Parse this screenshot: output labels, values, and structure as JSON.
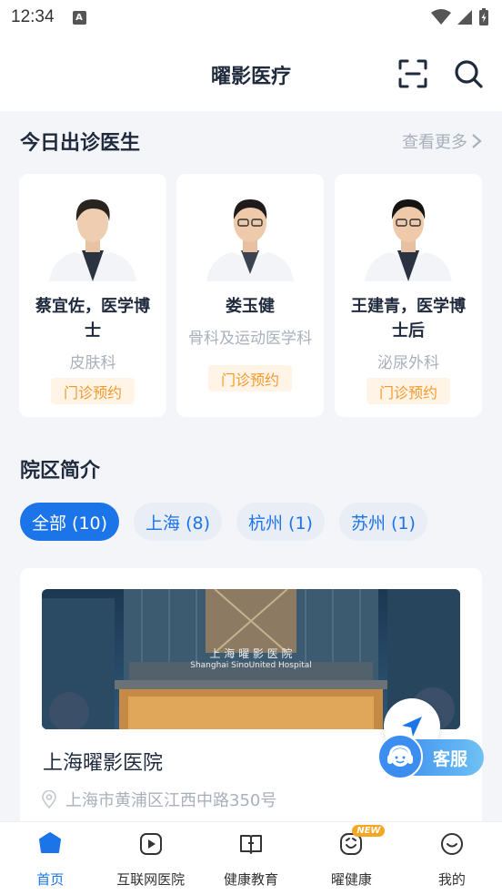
{
  "status_bar": {
    "time": "12:34",
    "notif_letter": "A"
  },
  "header": {
    "title": "曜影医疗",
    "scan_icon": "scan-icon",
    "search_icon": "search-icon"
  },
  "doctors_section": {
    "title": "今日出诊医生",
    "more": "查看更多",
    "doctors": [
      {
        "name": "蔡宜佐，医学博士",
        "dept": "皮肤科",
        "action": "门诊预约"
      },
      {
        "name": "娄玉健",
        "dept": "骨科及运动医学科",
        "action": "门诊预约"
      },
      {
        "name": "王建青，医学博士后",
        "dept": "泌尿外科",
        "action": "门诊预约"
      }
    ]
  },
  "campus_section": {
    "title": "院区简介",
    "filters": [
      "全部 (10)",
      "上海 (8)",
      "杭州 (1)",
      "苏州 (1)"
    ],
    "selected_filter": "全部 (10)",
    "hospital": {
      "sign_cn": "上 海 曜 影 医 院",
      "sign_en": "Shanghai SinoUnited Hospital",
      "name": "上海曜影医院",
      "address": "上海市黄浦区江西中路350号"
    }
  },
  "customer_service": {
    "label": "客服"
  },
  "tab_bar": {
    "tabs": [
      {
        "label": "首页",
        "icon": "home-icon"
      },
      {
        "label": "互联网医院",
        "icon": "play-icon"
      },
      {
        "label": "健康教育",
        "icon": "book-icon"
      },
      {
        "label": "曜健康",
        "icon": "health-icon"
      },
      {
        "label": "我的",
        "icon": "smile-icon"
      }
    ],
    "badge": "NEW"
  },
  "colors": {
    "accent": "#1c74e9",
    "appointment": "#f39a2e",
    "badge": "#f6a623"
  }
}
